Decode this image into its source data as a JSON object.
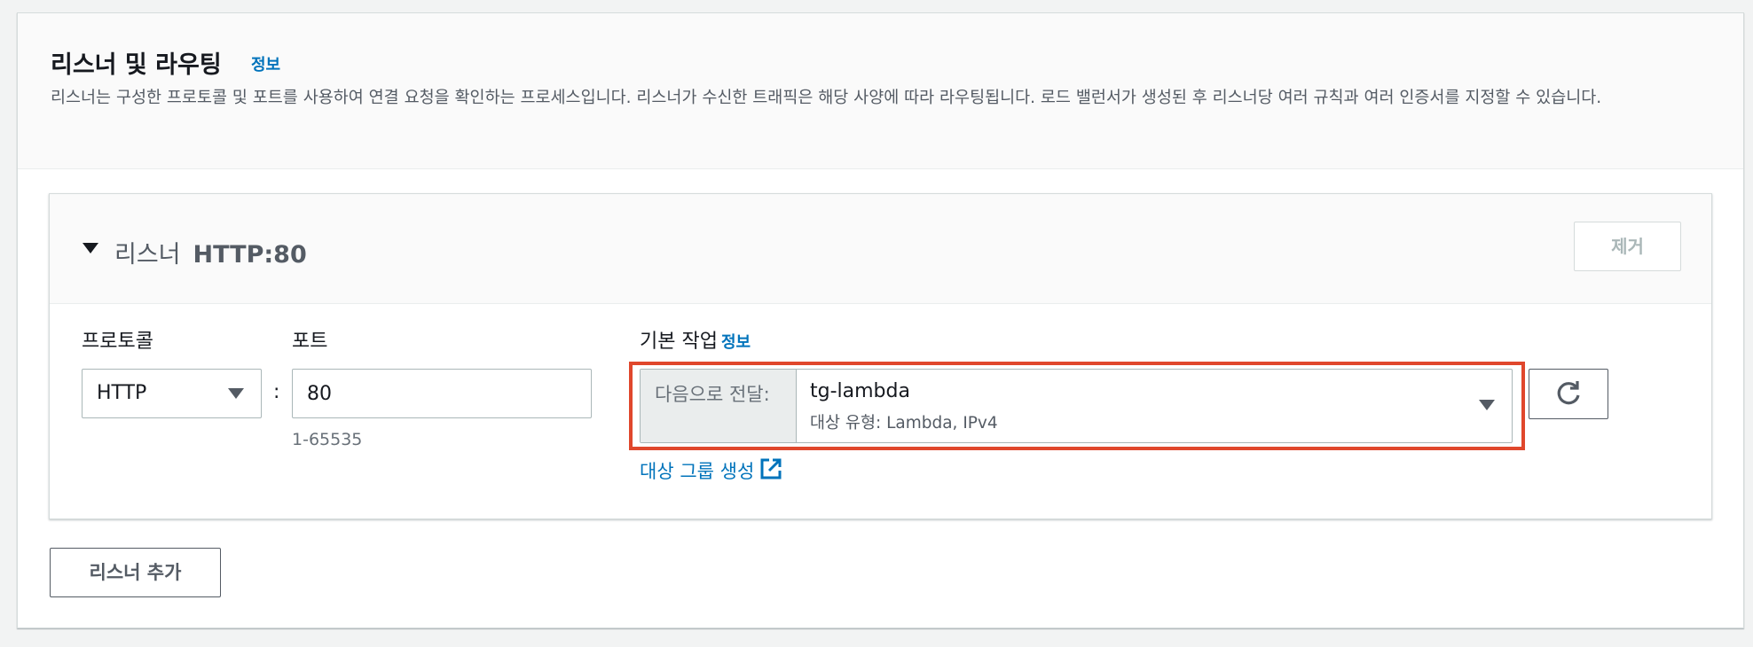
{
  "section": {
    "title": "리스너 및 라우팅",
    "info_label": "정보",
    "description": "리스너는 구성한 프로토콜 및 포트를 사용하여 연결 요청을 확인하는 프로세스입니다. 리스너가 수신한 트래픽은 해당 사양에 따라 라우팅됩니다. 로드 밸런서가 생성된 후 리스너당 여러 규칙과 여러 인증서를 지정할 수 있습니다."
  },
  "listener": {
    "label": "리스너",
    "protocol_port": "HTTP:80",
    "remove_label": "제거",
    "protocol_label": "프로토콜",
    "protocol_value": "HTTP",
    "port_label": "포트",
    "port_value": "80",
    "port_hint": "1-65535",
    "default_action_label": "기본 작업",
    "default_action_info": "정보",
    "action_prefix": "다음으로 전달:",
    "action_target": "tg-lambda",
    "action_target_desc": "대상 유형: Lambda, IPv4",
    "create_target_group": "대상 그룹 생성"
  },
  "add_listener_label": "리스너 추가",
  "colors": {
    "link": "#0073bb",
    "highlight": "#e0472c"
  }
}
